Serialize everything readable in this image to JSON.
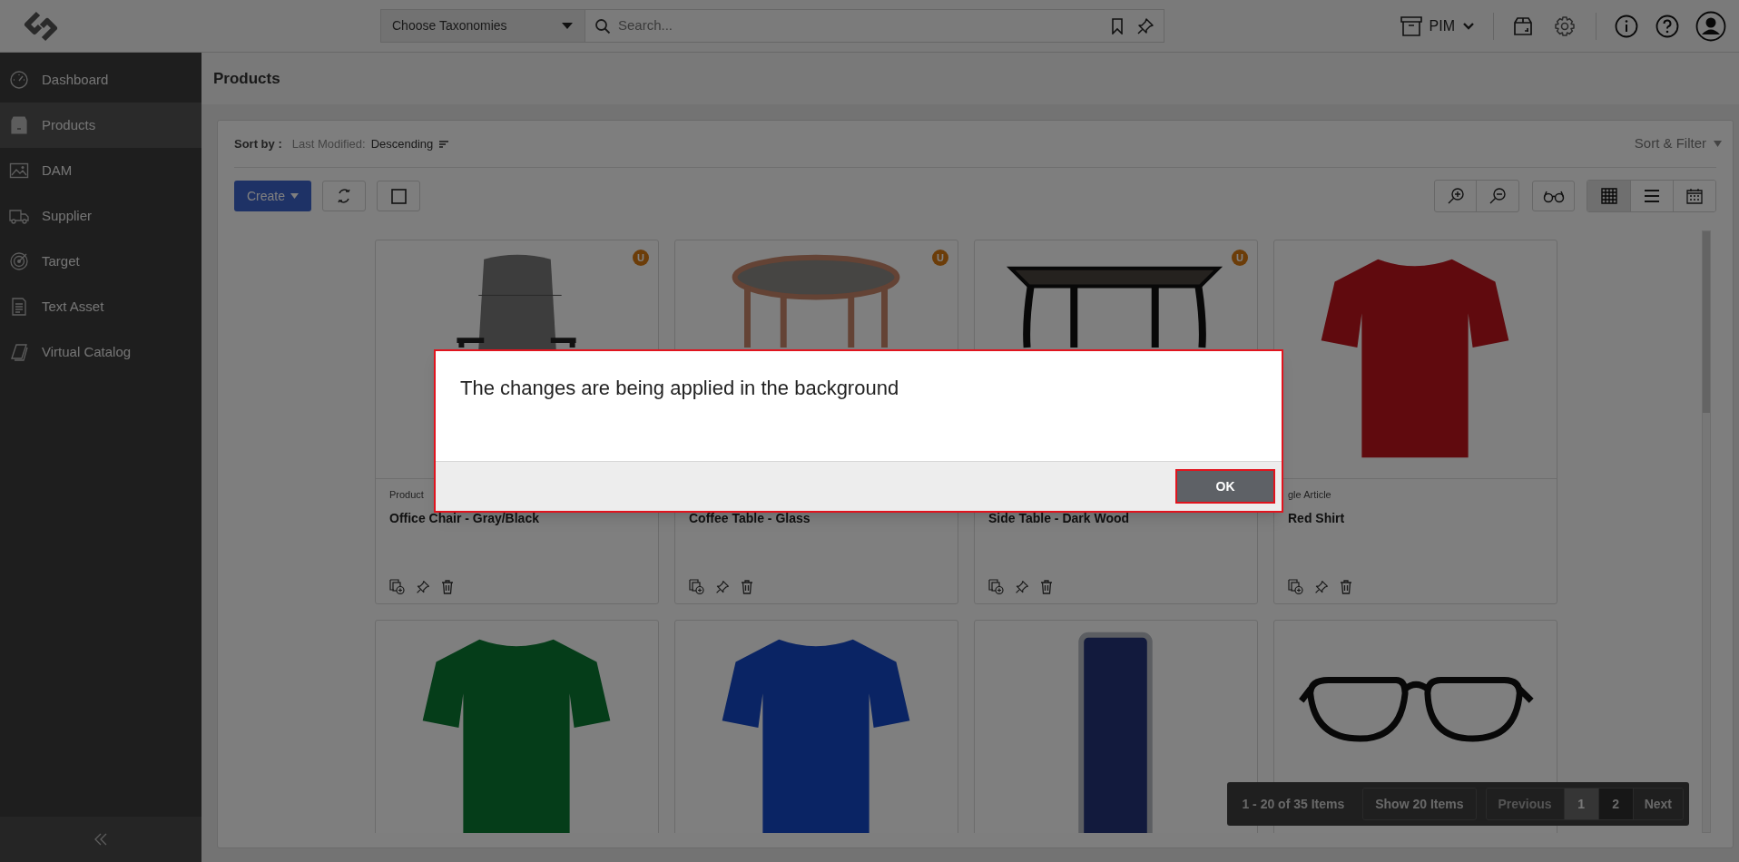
{
  "topbar": {
    "taxonomy_select": "Choose Taxonomies",
    "search": {
      "placeholder": "Search..."
    },
    "app_switcher": "PIM"
  },
  "sidebar": {
    "items": [
      {
        "label": "Dashboard",
        "kind": "gauge",
        "selected": false
      },
      {
        "label": "Products",
        "kind": "box",
        "selected": true
      },
      {
        "label": "DAM",
        "kind": "image",
        "selected": false
      },
      {
        "label": "Supplier",
        "kind": "truck",
        "selected": false
      },
      {
        "label": "Target",
        "kind": "target",
        "selected": false
      },
      {
        "label": "Text Asset",
        "kind": "document",
        "selected": false
      },
      {
        "label": "Virtual Catalog",
        "kind": "catalog",
        "selected": false
      }
    ]
  },
  "page_title": "Products",
  "sort": {
    "label": "Sort by :",
    "field": "Last Modified:",
    "order": "Descending"
  },
  "sort_filter": "Sort & Filter",
  "toolbar": {
    "create": "Create",
    "views": [
      {
        "kind": "grid",
        "selected": true
      },
      {
        "kind": "list",
        "selected": false
      },
      {
        "kind": "calendar",
        "selected": false
      }
    ]
  },
  "products": [
    {
      "type": "Product",
      "title": "Office Chair - Gray/Black",
      "badge": "U",
      "kind": "chair"
    },
    {
      "title": "Coffee Table - Glass",
      "badge": "U",
      "kind": "round-table"
    },
    {
      "title": "Side Table - Dark Wood",
      "badge": "U",
      "kind": "side-table"
    },
    {
      "type": "gle Article",
      "title": "Red Shirt",
      "kind": "shirt",
      "color": "#600a0e"
    },
    {
      "kind": "shirt",
      "color": "#053d19"
    },
    {
      "kind": "shirt",
      "color": "#0a2464"
    },
    {
      "kind": "can"
    },
    {
      "kind": "glasses"
    }
  ],
  "pagination": {
    "summary": "1 - 20 of 35 Items",
    "page_size": "Show 20 Items",
    "previous": {
      "label": "Previous",
      "disabled": true
    },
    "pages": [
      {
        "label": "1",
        "selected": true
      },
      {
        "label": "2",
        "selected": false
      }
    ],
    "next": "Next"
  },
  "dialog": {
    "message": "The changes are being applied in the background",
    "ok": "OK"
  }
}
